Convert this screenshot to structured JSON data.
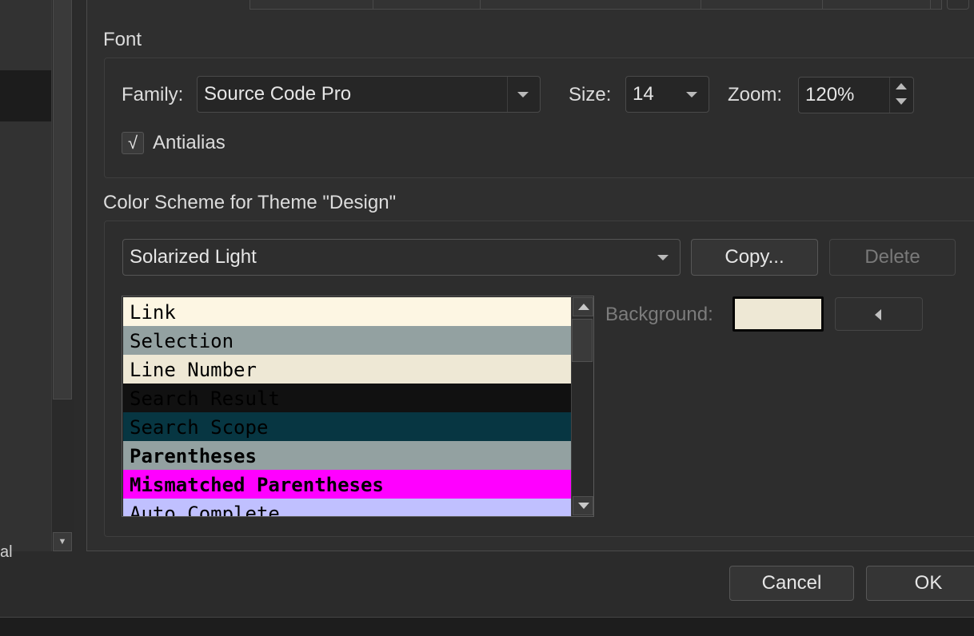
{
  "sidebar": {
    "fragment_text": "al"
  },
  "font_section": {
    "title": "Font",
    "family_label": "Family:",
    "family_value": "Source Code Pro",
    "size_label": "Size:",
    "size_value": "14",
    "zoom_label": "Zoom:",
    "zoom_value": "120%",
    "antialias_check": "√",
    "antialias_label": "Antialias",
    "antialias_checked": true
  },
  "color_section": {
    "title": "Color Scheme for Theme \"Design\"",
    "scheme_value": "Solarized Light",
    "copy_label": "Copy...",
    "delete_label": "Delete",
    "background_label": "Background:",
    "background_swatch": "#eee8d5",
    "items": [
      {
        "label": "Link",
        "bg": "#fdf6e3",
        "fg": "#000000",
        "bold": false
      },
      {
        "label": "Selection",
        "bg": "#93a1a1",
        "fg": "#000000",
        "bold": false
      },
      {
        "label": "Line Number",
        "bg": "#eee8d5",
        "fg": "#000000",
        "bold": false
      },
      {
        "label": "Search Result",
        "bg": "#111111",
        "fg": "#000000",
        "bold": false
      },
      {
        "label": "Search Scope",
        "bg": "#073642",
        "fg": "#000000",
        "bold": false
      },
      {
        "label": "Parentheses",
        "bg": "#93a1a1",
        "fg": "#000000",
        "bold": true
      },
      {
        "label": "Mismatched Parentheses",
        "bg": "#ff00ff",
        "fg": "#000000",
        "bold": true
      },
      {
        "label": "Auto Complete",
        "bg": "#c0c0ff",
        "fg": "#000000",
        "bold": false
      }
    ]
  },
  "dialog": {
    "cancel_label": "Cancel",
    "ok_label": "OK"
  },
  "icons": {
    "antialias_check": "check-icon",
    "clear_color": "triangle-left-icon"
  }
}
